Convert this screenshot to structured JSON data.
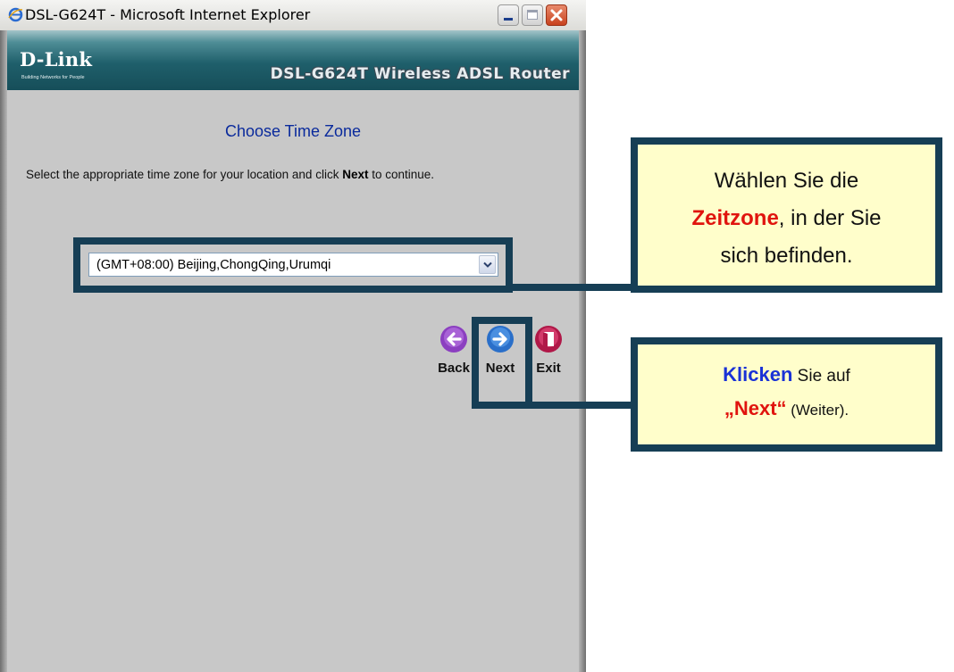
{
  "window": {
    "title": "DSL-G624T - Microsoft Internet Explorer"
  },
  "banner": {
    "logo": "D-Link",
    "tagline": "Building Networks for People",
    "product": "DSL-G624T Wireless ADSL Router"
  },
  "page": {
    "title": "Choose Time Zone",
    "instructions_before": "Select the appropriate time zone for your location and click ",
    "instructions_bold": "Next",
    "instructions_after": " to continue."
  },
  "time_zone": {
    "selected": "(GMT+08:00) Beijing,ChongQing,Urumqi"
  },
  "buttons": {
    "back": "Back",
    "next": "Next",
    "exit": "Exit"
  },
  "callouts": {
    "timezone": {
      "line1": "Wählen Sie die",
      "highlight": "Zeitzone",
      "line2_rest": ", in der Sie",
      "line3": "sich befinden."
    },
    "next": {
      "bold": "Klicken",
      "rest": " Sie auf",
      "quote": "„Next“",
      "paren": " (Weiter)."
    }
  },
  "colors": {
    "annotation_border": "#163e55",
    "callout_fill": "#fffecb",
    "title_blue": "#0a2a9c",
    "highlight_red": "#e0140e",
    "highlight_blue": "#1a32d6"
  },
  "icons": {
    "back": "arrow-left-circle-icon",
    "next": "arrow-right-circle-icon",
    "exit": "exit-door-icon",
    "dropdown": "chevron-down-icon"
  }
}
